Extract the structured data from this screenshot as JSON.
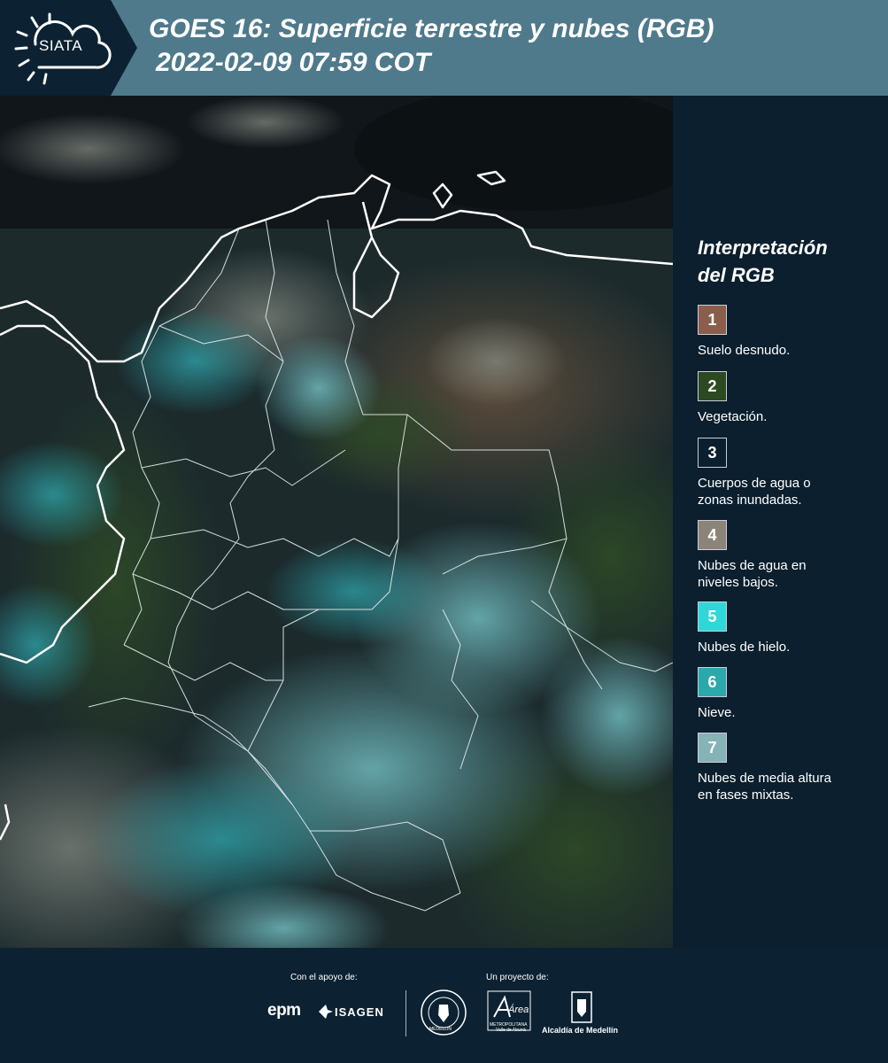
{
  "header": {
    "logo_text": "SIATA",
    "title_line1": "GOES 16: Superficie terrestre y nubes (RGB)",
    "title_line2": "2022-02-09 07:59 COT"
  },
  "legend": {
    "title_line1": "Interpretación",
    "title_line2": "del RGB",
    "items": [
      {
        "num": "1",
        "color": "#8a5e4b",
        "label_line1": "Suelo desnudo.",
        "label_line2": ""
      },
      {
        "num": "2",
        "color": "#2c4a22",
        "label_line1": "Vegetación.",
        "label_line2": ""
      },
      {
        "num": "3",
        "color": "#0b1f2e",
        "label_line1": "Cuerpos de agua o",
        "label_line2": "zonas inundadas."
      },
      {
        "num": "4",
        "color": "#8c8478",
        "label_line1": "Nubes de agua en",
        "label_line2": "niveles bajos."
      },
      {
        "num": "5",
        "color": "#2fd8d8",
        "label_line1": "Nubes de hielo.",
        "label_line2": ""
      },
      {
        "num": "6",
        "color": "#2aa9ab",
        "label_line1": "Nieve.",
        "label_line2": ""
      },
      {
        "num": "7",
        "color": "#86b3b5",
        "label_line1": "Nubes de media altura",
        "label_line2": "en fases mixtas."
      }
    ]
  },
  "footer": {
    "support_label": "Con el apoyo de:",
    "project_label": "Un proyecto de:",
    "epm_logo": "epm",
    "isagen_logo": "ISAGEN",
    "metropolitana_logo": "Área",
    "metropolitana_sub": "METROPOLITANA",
    "metropolitana_sub2": "Valle de Aburrá",
    "alcaldia_logo": "Alcaldía de Medellín",
    "seal_text": "MEDELLIN"
  }
}
